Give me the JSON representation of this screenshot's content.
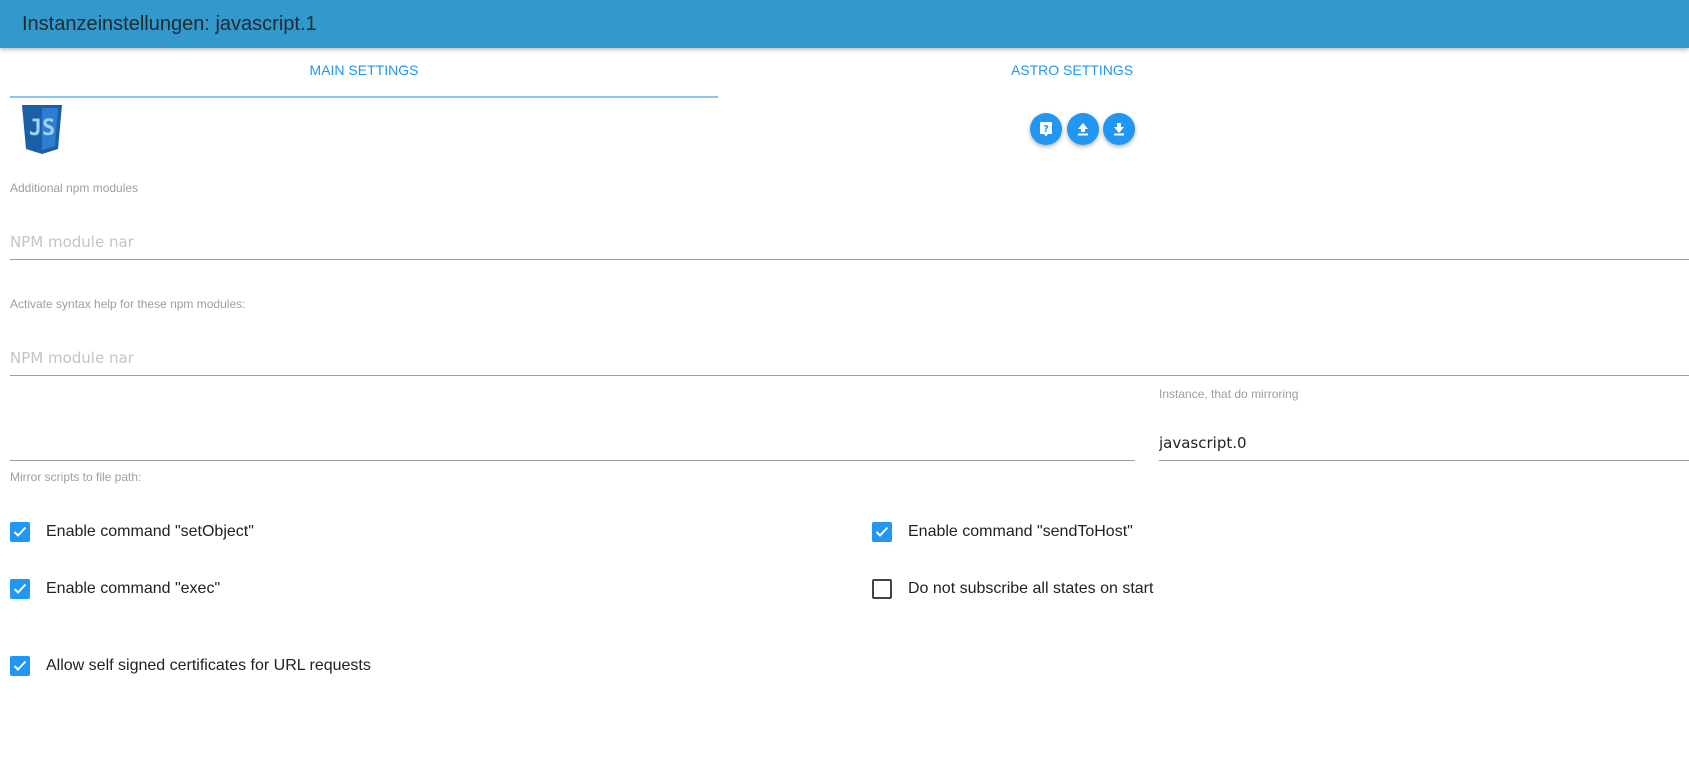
{
  "window": {
    "title": "Instanzeinstellungen: javascript.1",
    "header_color": "#3399cc"
  },
  "tabs": [
    {
      "label": "MAIN SETTINGS",
      "active": true
    },
    {
      "label": "ASTRO SETTINGS",
      "active": false
    }
  ],
  "logo": {
    "icon": "javascript-logo-icon",
    "text": "JS"
  },
  "toolbar": {
    "buttons": [
      {
        "icon": "help-icon"
      },
      {
        "icon": "upload-icon"
      },
      {
        "icon": "download-icon"
      }
    ]
  },
  "fields": {
    "npm_modules": {
      "label": "Additional npm modules",
      "placeholder": "NPM module nar",
      "value": ""
    },
    "syntax_help": {
      "label": "Activate syntax help for these npm modules:",
      "placeholder": "NPM module nar",
      "value": ""
    },
    "mirror_path": {
      "label": "Mirror scripts to file path:",
      "value": ""
    },
    "mirror_instance": {
      "label": "Instance, that do mirroring",
      "value": "javascript.0"
    }
  },
  "checkboxes": {
    "set_object": {
      "label": "Enable command \"setObject\"",
      "checked": true
    },
    "send_to_host": {
      "label": "Enable command \"sendToHost\"",
      "checked": true
    },
    "exec": {
      "label": "Enable command \"exec\"",
      "checked": true
    },
    "no_subscribe": {
      "label": "Do not subscribe all states on start",
      "checked": false
    },
    "self_signed": {
      "label": "Allow self signed certificates for URL requests",
      "checked": true
    }
  },
  "colors": {
    "accent": "#2196f3",
    "label_gray": "#9e9e9e",
    "logo_blue": "#1b5fa6"
  }
}
